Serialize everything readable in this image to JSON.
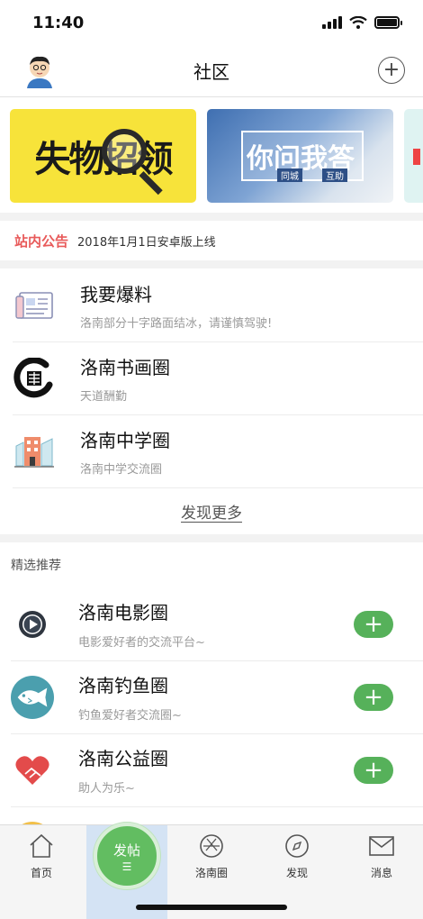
{
  "status_bar": {
    "time": "11:40",
    "battery_level": 1.0
  },
  "header": {
    "title": "社区"
  },
  "banners": [
    {
      "text": "失物招领"
    },
    {
      "text": "你问我答",
      "tags": [
        "同城",
        "互助"
      ]
    }
  ],
  "notice": {
    "tag": "站内公告",
    "text": "2018年1月1日安卓版上线"
  },
  "circles": [
    {
      "title": "我要爆料",
      "desc": "洛南部分十字路面结冰，请谨慎驾驶!",
      "icon": "newspaper-icon"
    },
    {
      "title": "洛南书画圈",
      "desc": "天道酬勤",
      "icon": "calligraphy-icon"
    },
    {
      "title": "洛南中学圈",
      "desc": "洛南中学交流圈",
      "icon": "school-building-icon"
    }
  ],
  "more_label": "发现更多",
  "recommend": {
    "heading": "精选推荐",
    "items": [
      {
        "title": "洛南电影圈",
        "desc": "电影爱好者的交流平台~",
        "icon": "play-icon",
        "color": "#2f3640"
      },
      {
        "title": "洛南钓鱼圈",
        "desc": "钓鱼爱好者交流圈~",
        "icon": "fish-icon",
        "color": "#4b9fae"
      },
      {
        "title": "洛南公益圈",
        "desc": "助人为乐~",
        "icon": "heart-hands-icon",
        "color": "#e34b4b"
      }
    ],
    "join_label": "+"
  },
  "tabs": [
    {
      "label": "首页",
      "icon": "home-icon"
    },
    {
      "label": "发帖",
      "icon": "post-icon"
    },
    {
      "label": "洛南圈",
      "icon": "aperture-icon"
    },
    {
      "label": "发现",
      "icon": "compass-icon"
    },
    {
      "label": "消息",
      "icon": "mail-icon"
    }
  ],
  "colors": {
    "accent_green": "#56b15a",
    "notice_red": "#e85a5a"
  }
}
